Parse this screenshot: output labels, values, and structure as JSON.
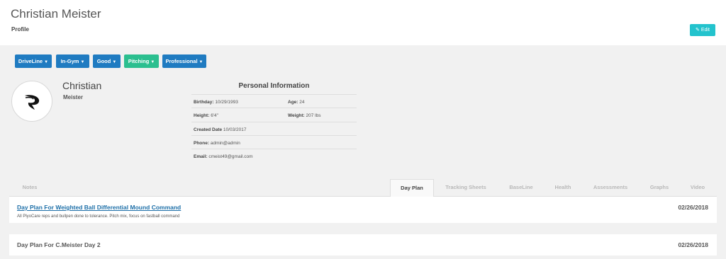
{
  "header": {
    "title": "Christian Meister",
    "subtitle": "Profile",
    "edit_label": "Edit",
    "edit_icon": "edit-icon",
    "accent_color": "#23c3cd"
  },
  "tags": [
    {
      "label": "DriveLine",
      "color": "#1f7bc1"
    },
    {
      "label": "In-Gym",
      "color": "#1f7bc1"
    },
    {
      "label": "Good",
      "color": "#1f7bc1"
    },
    {
      "label": "Pitching",
      "color": "#2bbf8f"
    },
    {
      "label": "Professional",
      "color": "#1f7bc1"
    }
  ],
  "profile": {
    "first_name": "Christian",
    "last_name": "Meister",
    "avatar_icon": "driveline-logo-icon"
  },
  "personal_info": {
    "title": "Personal Information",
    "birthday_label": "Birthday:",
    "birthday": "10/29/1993",
    "age_label": "Age:",
    "age": "24",
    "height_label": "Height:",
    "height": "6'4\"",
    "weight_label": "Weight:",
    "weight": "207 lbs",
    "created_label": "Created Date",
    "created": "10/03/2017",
    "phone_label": "Phone:",
    "phone": "admin@admin",
    "email_label": "Email:",
    "email": "cmeist49@gmail.com"
  },
  "tabs": [
    "Notes",
    "Day Plan",
    "Tracking Sheets",
    "BaseLine",
    "Health",
    "Assessments",
    "Graphs",
    "Video"
  ],
  "active_tab": "Day Plan",
  "entries": [
    {
      "title": "Day Plan For Weighted Ball Differential Mound Command",
      "description": "All PlyoCare reps and bullpen done to tolerance. Pitch mix, focus on fastball command",
      "date": "02/26/2018"
    },
    {
      "title": "Day Plan For C.Meister Day 2",
      "date": "02/26/2018"
    }
  ]
}
